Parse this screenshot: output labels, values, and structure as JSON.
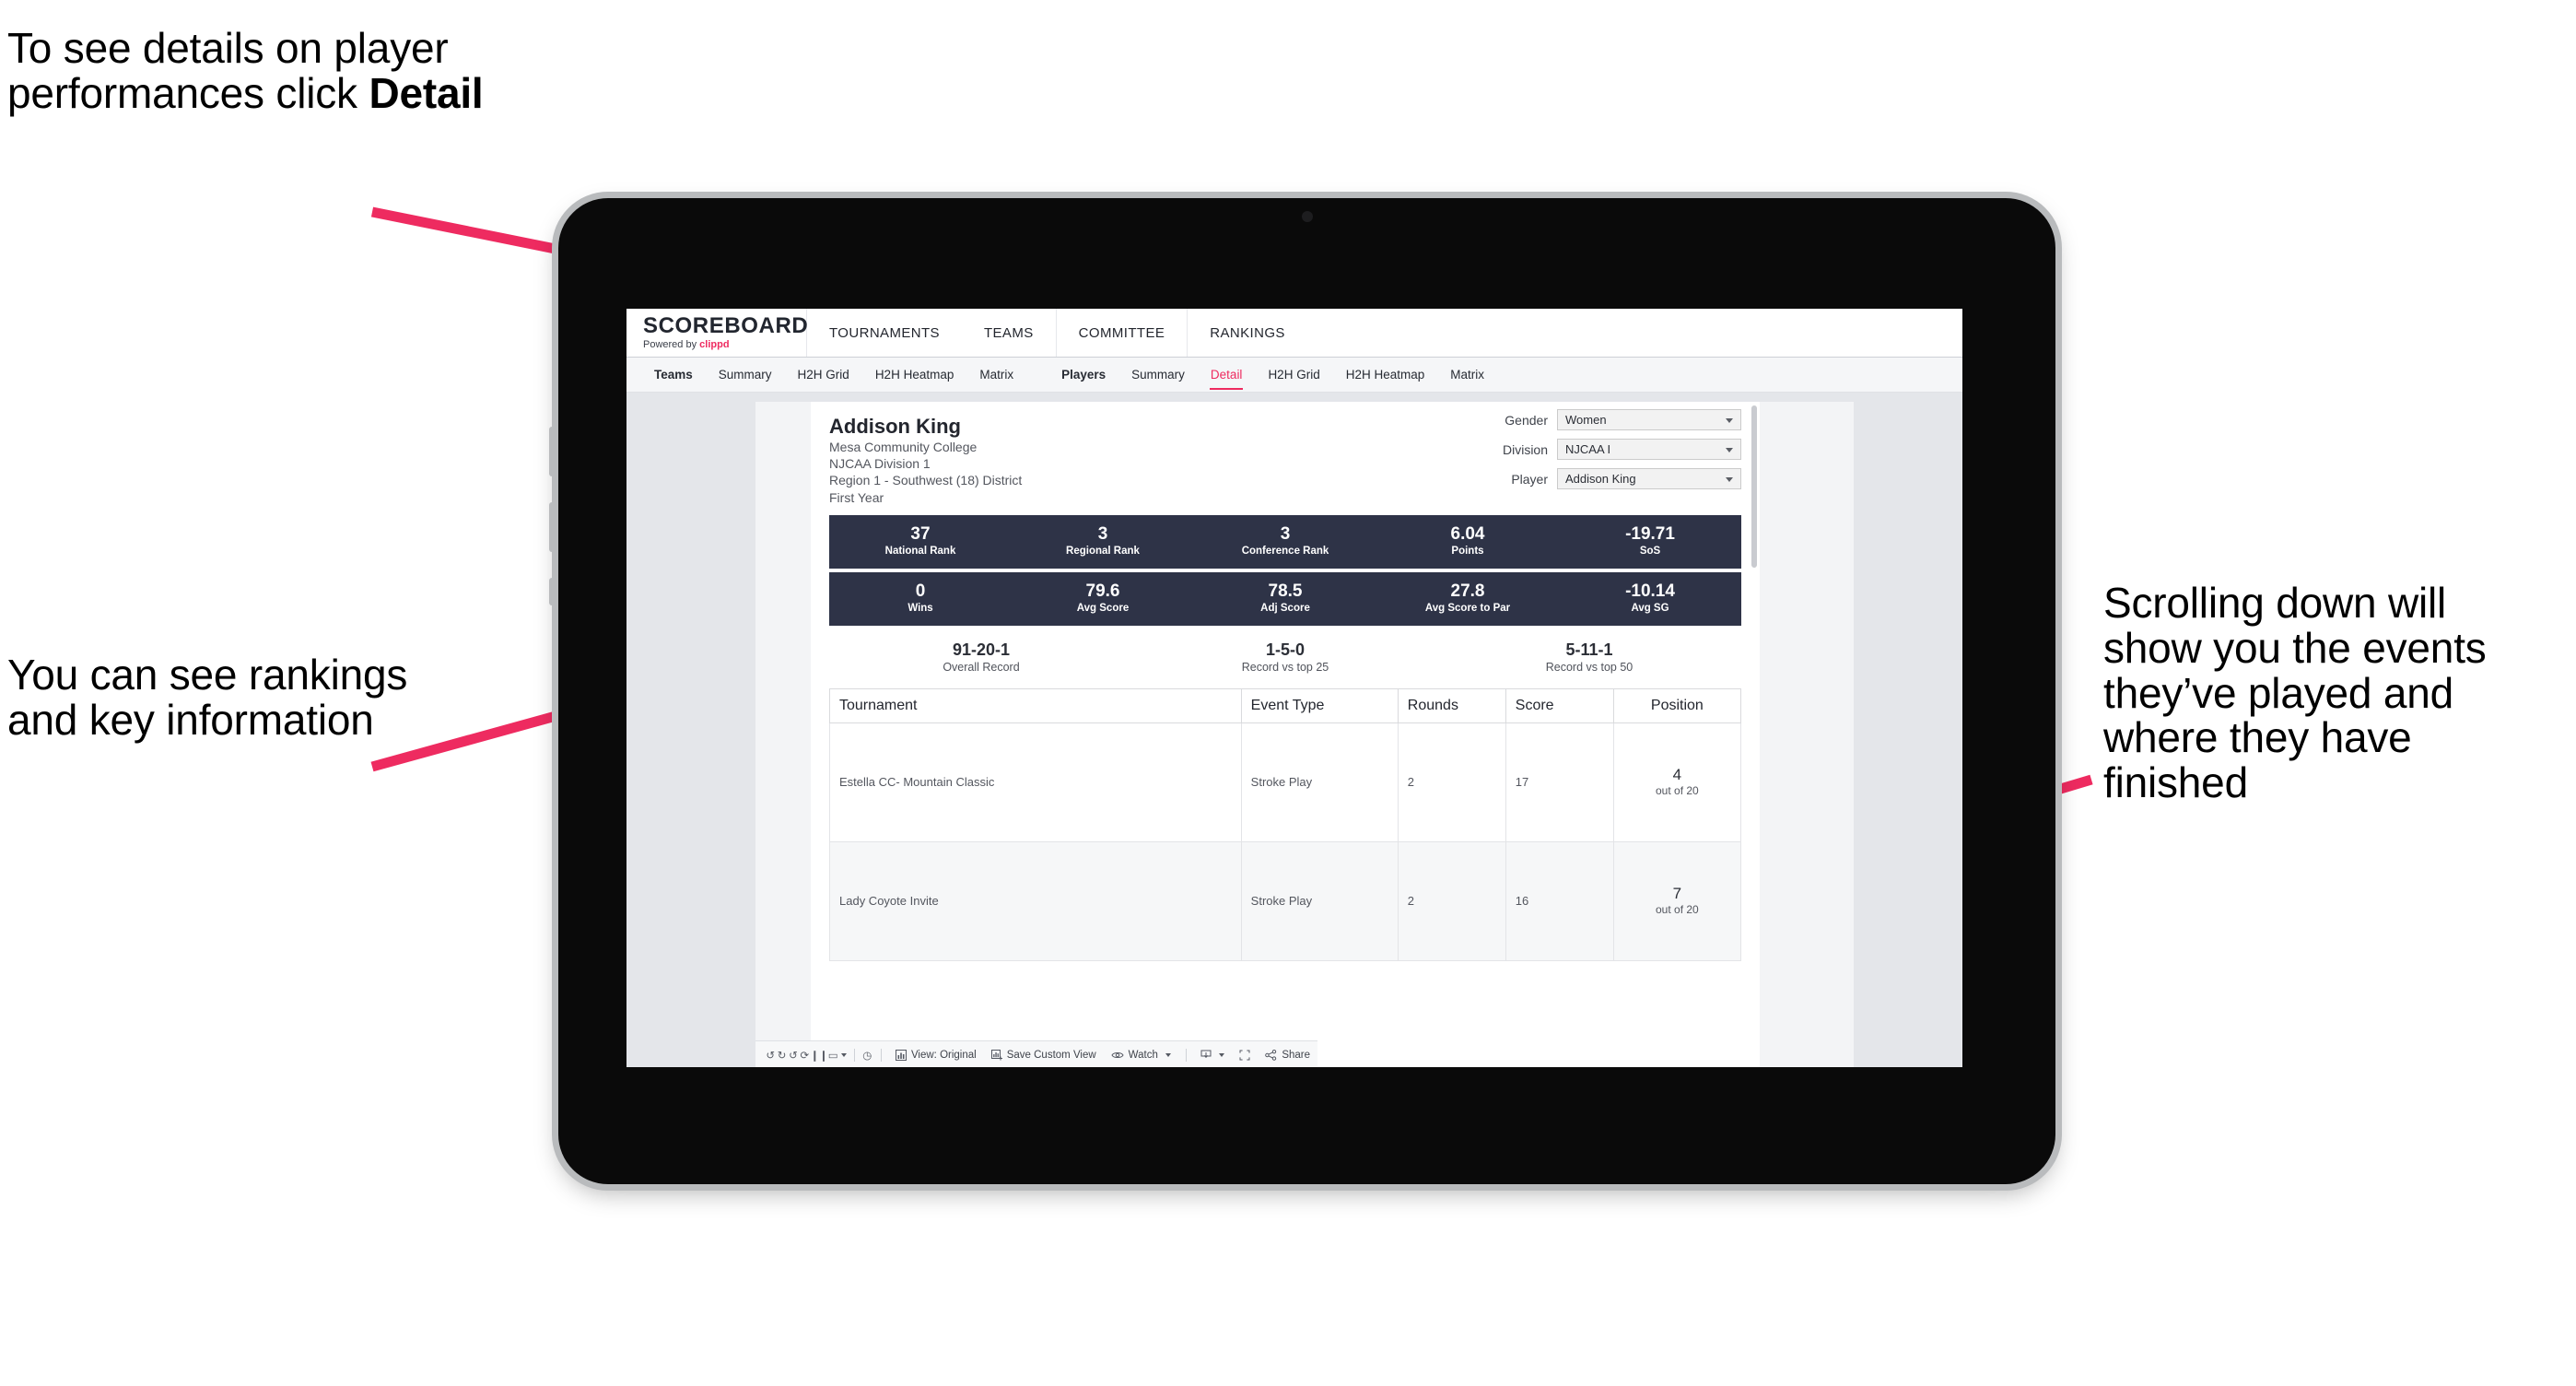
{
  "annotations": {
    "top_left": "To see details on player performances click ",
    "top_left_bold": "Detail",
    "mid_left": "You can see rankings and key information",
    "right": "Scrolling down will show you the events they’ve played and where they have finished"
  },
  "colors": {
    "accent_pink": "#ee2b60",
    "stat_band_navy": "#2e3347",
    "canvas_gray": "#e4e6ea"
  },
  "app": {
    "brand": {
      "title": "SCOREBOARD",
      "powered_prefix": "Powered by ",
      "powered_brand": "clippd"
    },
    "topnav": [
      {
        "label": "TOURNAMENTS"
      },
      {
        "label": "TEAMS"
      },
      {
        "label": "COMMITTEE"
      },
      {
        "label": "RANKINGS"
      }
    ],
    "subnav": {
      "group_teams": [
        {
          "label": "Teams",
          "bold": true,
          "active": false
        },
        {
          "label": "Summary",
          "bold": false,
          "active": false
        },
        {
          "label": "H2H Grid",
          "bold": false,
          "active": false
        },
        {
          "label": "H2H Heatmap",
          "bold": false,
          "active": false
        },
        {
          "label": "Matrix",
          "bold": false,
          "active": false
        }
      ],
      "group_players": [
        {
          "label": "Players",
          "bold": true,
          "active": false
        },
        {
          "label": "Summary",
          "bold": false,
          "active": false
        },
        {
          "label": "Detail",
          "bold": false,
          "active": true
        },
        {
          "label": "H2H Grid",
          "bold": false,
          "active": false
        },
        {
          "label": "H2H Heatmap",
          "bold": false,
          "active": false
        },
        {
          "label": "Matrix",
          "bold": false,
          "active": false
        }
      ]
    }
  },
  "player": {
    "name": "Addison King",
    "school": "Mesa Community College",
    "division": "NJCAA Division 1",
    "region": "Region 1 - Southwest (18) District",
    "year": "First Year"
  },
  "filters": [
    {
      "label": "Gender",
      "value": "Women"
    },
    {
      "label": "Division",
      "value": "NJCAA I"
    },
    {
      "label": "Player",
      "value": "Addison King"
    }
  ],
  "stat_bands": [
    [
      {
        "value": "37",
        "label": "National Rank"
      },
      {
        "value": "3",
        "label": "Regional Rank"
      },
      {
        "value": "3",
        "label": "Conference Rank"
      },
      {
        "value": "6.04",
        "label": "Points"
      },
      {
        "value": "-19.71",
        "label": "SoS"
      }
    ],
    [
      {
        "value": "0",
        "label": "Wins"
      },
      {
        "value": "79.6",
        "label": "Avg Score"
      },
      {
        "value": "78.5",
        "label": "Adj Score"
      },
      {
        "value": "27.8",
        "label": "Avg Score to Par"
      },
      {
        "value": "-10.14",
        "label": "Avg SG"
      }
    ]
  ],
  "records": [
    {
      "value": "91-20-1",
      "label": "Overall Record"
    },
    {
      "value": "1-5-0",
      "label": "Record vs top 25"
    },
    {
      "value": "5-11-1",
      "label": "Record vs top 50"
    }
  ],
  "events_table": {
    "columns": [
      "Tournament",
      "Event Type",
      "Rounds",
      "Score",
      "Position"
    ],
    "rows": [
      {
        "tournament": "Estella CC- Mountain Classic",
        "event_type": "Stroke Play",
        "rounds": "2",
        "score": "17",
        "position_num": "4",
        "position_of": "out of 20"
      },
      {
        "tournament": "Lady Coyote Invite",
        "event_type": "Stroke Play",
        "rounds": "2",
        "score": "16",
        "position_num": "7",
        "position_of": "out of 20"
      }
    ]
  },
  "toolbar": {
    "icons": [
      {
        "name": "undo-icon",
        "glyph": "↺"
      },
      {
        "name": "redo-icon",
        "glyph": "↻"
      },
      {
        "name": "revert-icon",
        "glyph": "↺"
      },
      {
        "name": "refresh-data-icon",
        "glyph": "⟳"
      },
      {
        "name": "pause-updates-icon",
        "glyph": "❙❙"
      },
      {
        "name": "highlight-icon",
        "glyph": "▭"
      },
      {
        "name": "clock-icon",
        "glyph": "◷"
      }
    ],
    "view_label": "View: Original",
    "save_label": "Save Custom View",
    "watch_label": "Watch",
    "share_label": "Share"
  }
}
